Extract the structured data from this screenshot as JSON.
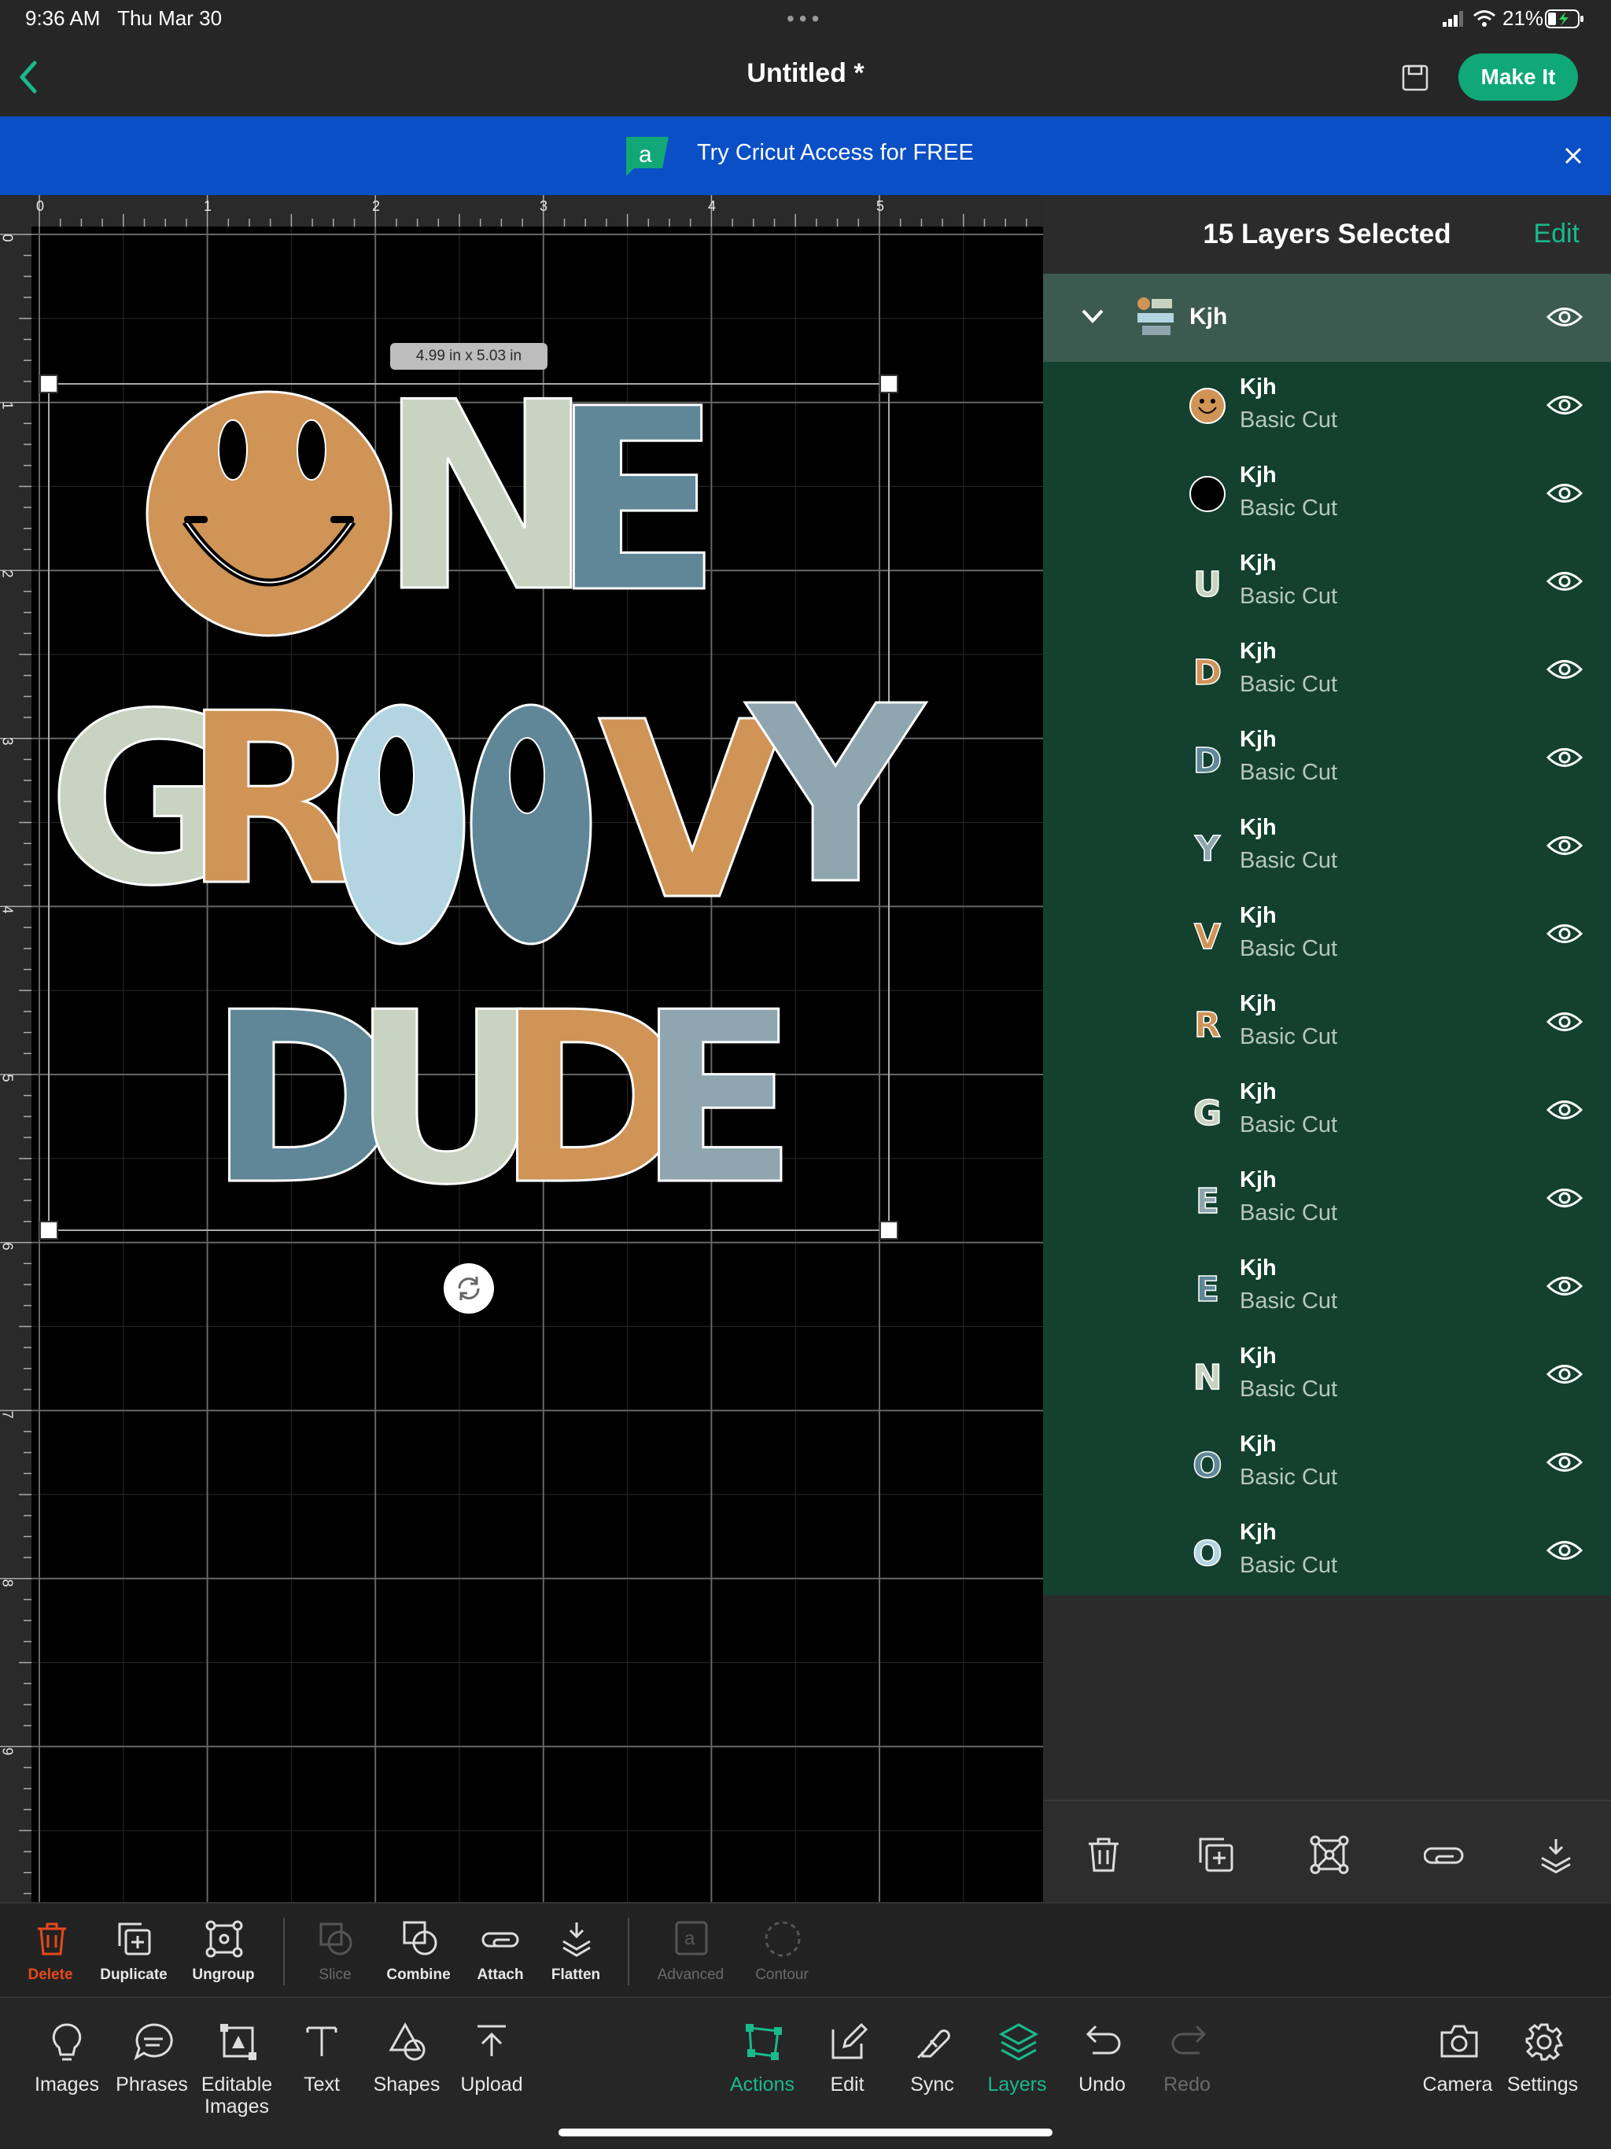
{
  "status_bar": {
    "time": "9:36 AM",
    "date": "Thu Mar 30",
    "battery": "21%"
  },
  "header": {
    "title": "Untitled *",
    "make_it_label": "Make It"
  },
  "banner": {
    "text": "Try Cricut Access for FREE"
  },
  "canvas": {
    "ruler_top": [
      "0",
      "1",
      "2",
      "3",
      "4",
      "5"
    ],
    "ruler_left": [
      "0",
      "1",
      "2",
      "3",
      "4",
      "5",
      "6",
      "7",
      "8",
      "9"
    ],
    "size_badge": "4.99 in x 5.03 in",
    "design_text": {
      "line1": "ONE",
      "line2": "GROOVY",
      "line3": "DUDE"
    }
  },
  "layers": {
    "title": "15 Layers Selected",
    "edit_label": "Edit",
    "group_name": "Kjh",
    "items": [
      {
        "name": "Kjh",
        "type": "Basic Cut",
        "thumb": "smiley-face",
        "color": "#d09457"
      },
      {
        "name": "Kjh",
        "type": "Basic Cut",
        "thumb": "black-circle",
        "color": "#000000"
      },
      {
        "name": "Kjh",
        "type": "Basic Cut",
        "thumb": "U",
        "color": "#c8d4c1"
      },
      {
        "name": "Kjh",
        "type": "Basic Cut",
        "thumb": "D",
        "color": "#d09457"
      },
      {
        "name": "Kjh",
        "type": "Basic Cut",
        "thumb": "D",
        "color": "#5f8797"
      },
      {
        "name": "Kjh",
        "type": "Basic Cut",
        "thumb": "Y",
        "color": "#8fa6b0"
      },
      {
        "name": "Kjh",
        "type": "Basic Cut",
        "thumb": "V",
        "color": "#d09457"
      },
      {
        "name": "Kjh",
        "type": "Basic Cut",
        "thumb": "R",
        "color": "#d09457"
      },
      {
        "name": "Kjh",
        "type": "Basic Cut",
        "thumb": "G",
        "color": "#c8d4c1"
      },
      {
        "name": "Kjh",
        "type": "Basic Cut",
        "thumb": "E",
        "color": "#8fa6b0"
      },
      {
        "name": "Kjh",
        "type": "Basic Cut",
        "thumb": "E",
        "color": "#5f8797"
      },
      {
        "name": "Kjh",
        "type": "Basic Cut",
        "thumb": "N",
        "color": "#c8d4c1"
      },
      {
        "name": "Kjh",
        "type": "Basic Cut",
        "thumb": "O",
        "color": "#5f8797"
      },
      {
        "name": "Kjh",
        "type": "Basic Cut",
        "thumb": "O",
        "color": "#b3d5e2"
      }
    ]
  },
  "edit_toolbar": {
    "delete": "Delete",
    "duplicate": "Duplicate",
    "ungroup": "Ungroup",
    "slice": "Slice",
    "combine": "Combine",
    "attach": "Attach",
    "flatten": "Flatten",
    "advanced": "Advanced",
    "contour": "Contour"
  },
  "bottom_nav": {
    "images": "Images",
    "phrases": "Phrases",
    "editable_images": "Editable Images",
    "text": "Text",
    "shapes": "Shapes",
    "upload": "Upload",
    "actions": "Actions",
    "edit": "Edit",
    "sync": "Sync",
    "layers": "Layers",
    "undo": "Undo",
    "redo": "Redo",
    "camera": "Camera",
    "settings": "Settings"
  },
  "colors": {
    "accent": "#19b98a",
    "make_it_bg": "#0fa876",
    "banner_bg": "#0b4fc6",
    "layer_list_bg": "#13402f",
    "orange": "#d09457",
    "sage": "#c8d4c1",
    "teal": "#5f8797",
    "slate": "#8fa6b0",
    "light_blue": "#b3d5e2",
    "delete_red": "#e64a19"
  }
}
